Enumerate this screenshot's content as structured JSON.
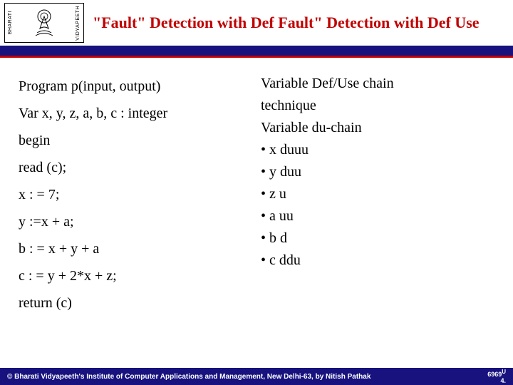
{
  "header": {
    "logo_left_text": "BHARATI",
    "logo_right_text": "VIDYAPEETH",
    "title": "\"Fault\" Detection with Def Fault\" Detection with Def Use"
  },
  "program": {
    "lines": [
      "Program p(input, output)",
      "Var x, y, z, a, b, c : integer",
      "begin",
      "read (c);",
      "x : = 7;",
      "y :=x + a;",
      "b : = x + y + a",
      "c : = y + 2*x + z;",
      "return (c)"
    ]
  },
  "duchain": {
    "heading_line1": "Variable Def/Use chain",
    "heading_line2": "technique",
    "subheading": "Variable du-chain",
    "items": [
      "• x duuu",
      "• y duu",
      "• z u",
      "• a uu",
      "• b d",
      "• c ddu"
    ]
  },
  "footer": {
    "copyright": "© Bharati Vidyapeeth's Institute of Computer Applications and Management, New Delhi-63, by  Nitish Pathak",
    "page_primary": "6969",
    "page_sup": "U",
    "page_secondary": "4."
  }
}
